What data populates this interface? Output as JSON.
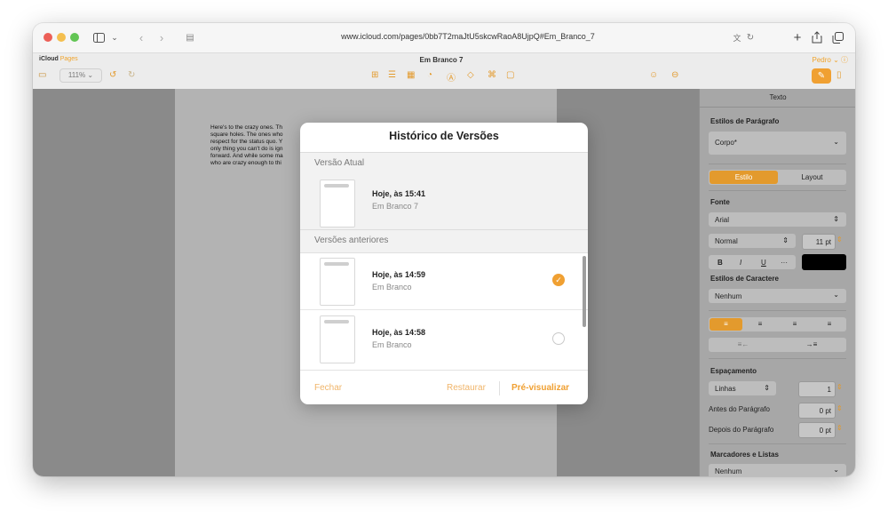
{
  "browser": {
    "url": "www.icloud.com/pages/0bb7T2maJtU5skcwRaoA8UjpQ#Em_Branco_7",
    "sidebar_icon": "sidebar-icon",
    "colors": {
      "close": "#ec5f57",
      "minimize": "#f4bf4f",
      "zoom": "#62c554"
    }
  },
  "app": {
    "brand": "iCloud",
    "brand_app": "Pages",
    "document_title": "Em Branco 7",
    "user": "Pedro",
    "zoom": "111%",
    "accent": "#f0a032"
  },
  "document": {
    "text_lines": [
      "Here's to the crazy ones. Th",
      "square holes. The ones who",
      "respect for the status quo. Y",
      "only thing you can't do is ign",
      "forward. And while some ma",
      "who are crazy enough to thi"
    ]
  },
  "inspector": {
    "tab_title": "Texto",
    "paragraph_styles_label": "Estilos de Parágrafo",
    "paragraph_style_value": "Corpo*",
    "seg_style": "Estilo",
    "seg_layout": "Layout",
    "font_label": "Fonte",
    "font_family": "Arial",
    "font_weight": "Normal",
    "font_size": "11 pt",
    "bold": "B",
    "italic": "I",
    "underline": "U",
    "more": "···",
    "char_styles_label": "Estilos de Caractere",
    "char_style_value": "Nenhum",
    "spacing_label": "Espaçamento",
    "spacing_type": "Linhas",
    "spacing_value": "1",
    "before_label": "Antes do Parágrafo",
    "before_value": "0 pt",
    "after_label": "Depois do Parágrafo",
    "after_value": "0 pt",
    "bullets_label": "Marcadores e Listas",
    "bullets_value": "Nenhum"
  },
  "dialog": {
    "title": "Histórico de Versões",
    "current_header": "Versão Atual",
    "current": {
      "title": "Hoje, às 15:41",
      "subtitle": "Em Branco 7"
    },
    "previous_header": "Versões anteriores",
    "previous": [
      {
        "title": "Hoje, às 14:59",
        "subtitle": "Em Branco",
        "selected": true
      },
      {
        "title": "Hoje, às 14:58",
        "subtitle": "Em Branco",
        "selected": false
      }
    ],
    "close_label": "Fechar",
    "restore_label": "Restaurar",
    "preview_label": "Pré-visualizar"
  }
}
